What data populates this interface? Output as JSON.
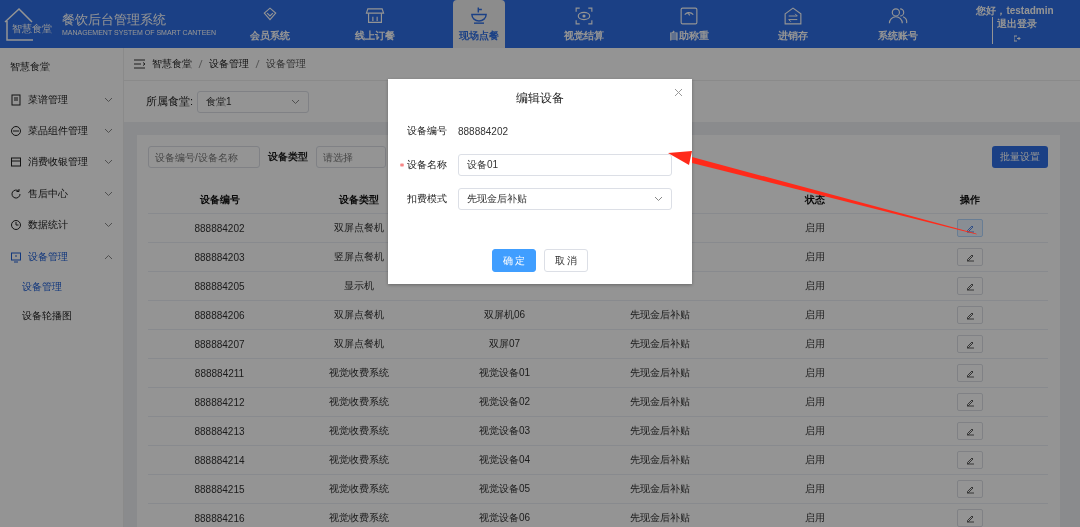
{
  "header": {
    "logo_text": "智慧食堂",
    "title": "餐饮后台管理系统",
    "subtitle": "MANAGEMENT SYSTEM OF SMART CANTEEN",
    "nav": [
      {
        "label": "会员系统",
        "selected": false
      },
      {
        "label": "线上订餐",
        "selected": false
      },
      {
        "label": "现场点餐",
        "selected": true
      },
      {
        "label": "视觉结算",
        "selected": false
      },
      {
        "label": "自助称重",
        "selected": false
      },
      {
        "label": "进销存",
        "selected": false
      },
      {
        "label": "系统账号",
        "selected": false
      }
    ],
    "greeting": "您好，testadmin",
    "logout": "退出登录"
  },
  "sidebar": {
    "title": "智慧食堂",
    "items": [
      {
        "label": "菜谱管理",
        "selected": false,
        "expanded": false
      },
      {
        "label": "菜品组件管理",
        "selected": false,
        "expanded": false
      },
      {
        "label": "消费收银管理",
        "selected": false,
        "expanded": false
      },
      {
        "label": "售后中心",
        "selected": false,
        "expanded": false
      },
      {
        "label": "数据统计",
        "selected": false,
        "expanded": false
      },
      {
        "label": "设备管理",
        "selected": true,
        "expanded": true,
        "children": [
          {
            "label": "设备管理",
            "selected": true
          },
          {
            "label": "设备轮播图",
            "selected": false
          }
        ]
      }
    ]
  },
  "breadcrumb": [
    "智慧食堂",
    "设备管理",
    "设备管理"
  ],
  "canteen_filter": {
    "label": "所属食堂:",
    "value": "食堂1"
  },
  "toolbar": {
    "search_placeholder": "设备编号/设备名称",
    "type_label": "设备类型",
    "type_placeholder": "请选择",
    "batch_button": "批量设置"
  },
  "table": {
    "columns": [
      "设备编号",
      "设备类型",
      null,
      null,
      "状态",
      "操作"
    ],
    "rows": [
      {
        "id": "888884202",
        "type": "双屏点餐机",
        "status": "启用",
        "focused": true
      },
      {
        "id": "888884203",
        "type": "竖屏点餐机",
        "status": "启用",
        "focused": false
      },
      {
        "id": "888884205",
        "type": "显示机",
        "status": "启用",
        "focused": false
      },
      {
        "id": "888884206",
        "type": "双屏点餐机",
        "column_3": "双屏机06",
        "column_4": "先现金后补贴",
        "status": "启用",
        "focused": false
      },
      {
        "id": "888884207",
        "type": "双屏点餐机",
        "column_3": "双屏07",
        "column_4": "先现金后补贴",
        "status": "启用",
        "focused": false
      },
      {
        "id": "888884211",
        "type": "视觉收费系统",
        "column_3": "视觉设备01",
        "column_4": "先现金后补贴",
        "status": "启用",
        "focused": false
      },
      {
        "id": "888884212",
        "type": "视觉收费系统",
        "column_3": "视觉设备02",
        "column_4": "先现金后补贴",
        "status": "启用",
        "focused": false
      },
      {
        "id": "888884213",
        "type": "视觉收费系统",
        "column_3": "视觉设备03",
        "column_4": "先现金后补贴",
        "status": "启用",
        "focused": false
      },
      {
        "id": "888884214",
        "type": "视觉收费系统",
        "column_3": "视觉设备04",
        "column_4": "先现金后补贴",
        "status": "启用",
        "focused": false
      },
      {
        "id": "888884215",
        "type": "视觉收费系统",
        "column_3": "视觉设备05",
        "column_4": "先现金后补贴",
        "status": "启用",
        "focused": false
      },
      {
        "id": "888884216",
        "type": "视觉收费系统",
        "column_3": "视觉设备06",
        "column_4": "先现金后补贴",
        "status": "启用",
        "focused": false
      }
    ]
  },
  "dialog": {
    "title": "编辑设备",
    "fields": [
      {
        "kind": "text",
        "label": "设备编号",
        "value": "888884202",
        "required": false
      },
      {
        "kind": "input",
        "label": "设备名称",
        "value": "设备01",
        "required": true
      },
      {
        "kind": "select",
        "label": "扣费模式",
        "value": "先现金后补贴",
        "required": false
      }
    ],
    "buttons": [
      {
        "label": "确 定",
        "kind": "primary"
      },
      {
        "label": "取 消",
        "kind": "default"
      }
    ]
  },
  "annotation": {
    "kind": "arrow"
  }
}
